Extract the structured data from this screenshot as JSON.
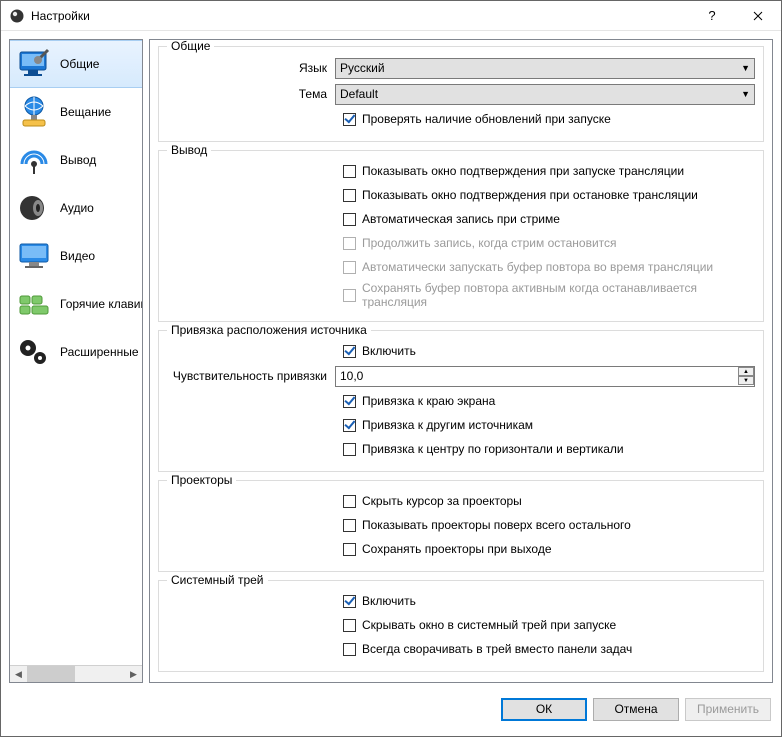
{
  "window": {
    "title": "Настройки"
  },
  "sidebar": {
    "items": [
      {
        "label": "Общие"
      },
      {
        "label": "Вещание"
      },
      {
        "label": "Вывод"
      },
      {
        "label": "Аудио"
      },
      {
        "label": "Видео"
      },
      {
        "label": "Горячие клавиши"
      },
      {
        "label": "Расширенные"
      }
    ]
  },
  "groups": {
    "general": {
      "title": "Общие",
      "lang_label": "Язык",
      "lang_value": "Русский",
      "theme_label": "Тема",
      "theme_value": "Default",
      "check_updates": "Проверять наличие обновлений при запуске"
    },
    "output": {
      "title": "Вывод",
      "cb1": "Показывать окно подтверждения при запуске трансляции",
      "cb2": "Показывать окно подтверждения при остановке трансляции",
      "cb3": "Автоматическая запись при стриме",
      "cb4": "Продолжить запись, когда стрим остановится",
      "cb5": "Автоматически запускать буфер повтора во время трансляции",
      "cb6": "Сохранять буфер повтора активным когда останавливается трансляция"
    },
    "snap": {
      "title": "Привязка расположения источника",
      "enable": "Включить",
      "sens_label": "Чувствительность привязки",
      "sens_value": "10,0",
      "edge": "Привязка к краю экрана",
      "other": "Привязка к другим источникам",
      "center": "Привязка к центру по горизонтали и вертикали"
    },
    "projectors": {
      "title": "Проекторы",
      "hide_cursor": "Скрыть курсор за проекторы",
      "always_on_top": "Показывать проекторы поверх всего остального",
      "save_on_exit": "Сохранять проекторы при выходе"
    },
    "tray": {
      "title": "Системный трей",
      "enable": "Включить",
      "minimize_start": "Скрывать окно в системный трей при запуске",
      "always_minimize": "Всегда сворачивать в трей вместо панели задач"
    }
  },
  "footer": {
    "ok": "ОК",
    "cancel": "Отмена",
    "apply": "Применить"
  }
}
